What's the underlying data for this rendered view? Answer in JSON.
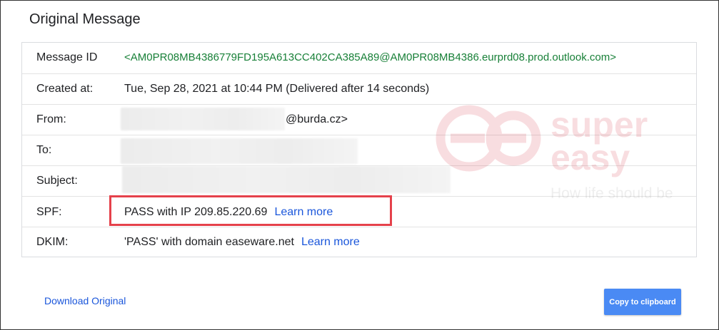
{
  "title": "Original Message",
  "rows": {
    "message_id": {
      "label": "Message ID",
      "value": "<AM0PR08MB4386779FD195A613CC402CA385A89@AM0PR08MB4386.eurprd08.prod.outlook.com>"
    },
    "created": {
      "label": "Created at:",
      "value": "Tue, Sep 28, 2021 at 10:44 PM (Delivered after 14 seconds)"
    },
    "from": {
      "label": "From:",
      "value": "@burda.cz>"
    },
    "to": {
      "label": "To:"
    },
    "subject": {
      "label": "Subject:"
    },
    "spf": {
      "label": "SPF:",
      "value": "PASS with IP 209.85.220.69",
      "link": "Learn more"
    },
    "dkim": {
      "label": "DKIM:",
      "value": "'PASS' with domain easeware.net",
      "link": "Learn more"
    }
  },
  "footer": {
    "download_label": "Download Original",
    "copy_label": "Copy to clipboard"
  },
  "watermark": {
    "brand_line1": "super",
    "brand_line2": "easy",
    "tagline": "How life should be"
  },
  "colors": {
    "link": "#1a56db",
    "message_id": "#188038",
    "highlight": "#e5414b",
    "button": "#4a8af4"
  }
}
